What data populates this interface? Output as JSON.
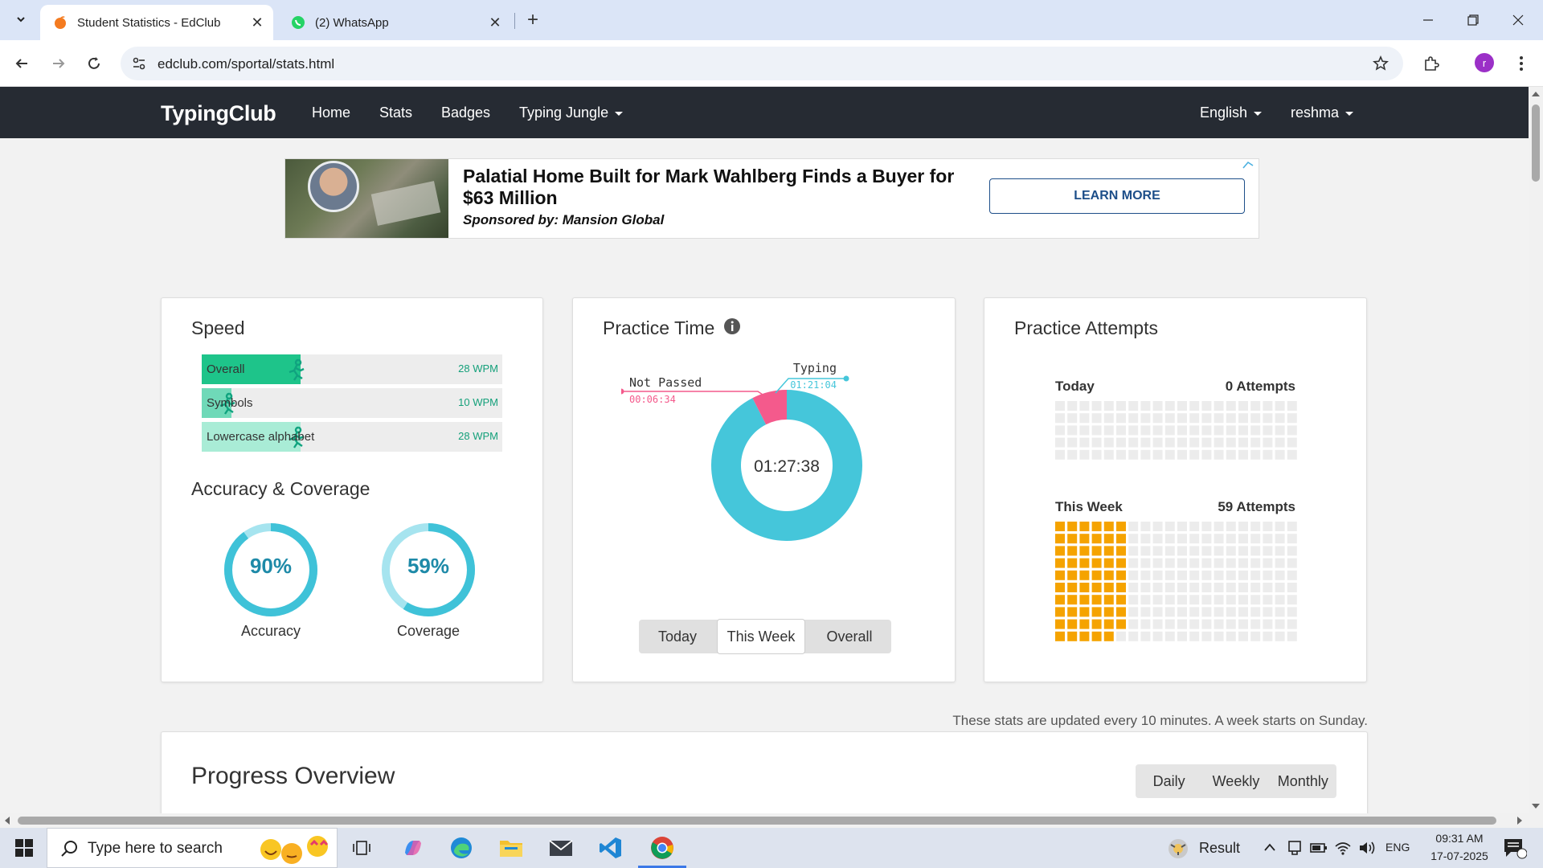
{
  "browser": {
    "tabs": [
      {
        "title": "Student Statistics - EdClub",
        "icon": "edclub-favicon",
        "active": true
      },
      {
        "title": "(2) WhatsApp",
        "icon": "whatsapp-favicon",
        "active": false
      }
    ],
    "url": "edclub.com/sportal/stats.html",
    "profile_initial": "r"
  },
  "nav": {
    "brand": "TypingClub",
    "links": [
      "Home",
      "Stats",
      "Badges",
      "Typing Jungle"
    ],
    "language": "English",
    "user": "reshma"
  },
  "ad": {
    "title": "Palatial Home Built for Mark Wahlberg Finds a Buyer for $63 Million",
    "sponsor": "Sponsored by: Mansion Global",
    "cta": "LEARN MORE"
  },
  "speed": {
    "title": "Speed",
    "rows": [
      {
        "label": "Overall",
        "value": "28 WPM",
        "fraction": 0.33,
        "color": "#1ec48a"
      },
      {
        "label": "Symbols",
        "value": "10 WPM",
        "fraction": 0.1,
        "color": "#6fd9b8"
      },
      {
        "label": "Lowercase alphabet",
        "value": "28 WPM",
        "fraction": 0.33,
        "color": "#a9ecd6"
      }
    ]
  },
  "accuracy": {
    "title": "Accuracy & Coverage",
    "items": [
      {
        "label": "Accuracy",
        "value": "90%",
        "fraction": 0.9
      },
      {
        "label": "Coverage",
        "value": "59%",
        "fraction": 0.59
      }
    ]
  },
  "practice_time": {
    "title": "Practice Time",
    "total": "01:27:38",
    "segments": [
      {
        "label": "Typing",
        "time": "01:21:04",
        "color": "#45c6da"
      },
      {
        "label": "Not Passed",
        "time": "00:06:34",
        "color": "#f45a8c"
      }
    ],
    "ranges": [
      "Today",
      "This Week",
      "Overall"
    ],
    "selected_range": "This Week"
  },
  "attempts": {
    "title": "Practice Attempts",
    "today_label": "Today",
    "today_value": "0 Attempts",
    "today_count": 0,
    "week_label": "This Week",
    "week_value": "59 Attempts",
    "week_count": 59,
    "fill_color": "#f5a300",
    "empty_color": "#ececec"
  },
  "footnote": "These stats are updated every 10 minutes. A week starts on Sunday.",
  "progress": {
    "title": "Progress Overview",
    "ranges": [
      "Daily",
      "Weekly",
      "Monthly"
    ]
  },
  "taskbar": {
    "search_placeholder": "Type here to search",
    "weather_label": "Result",
    "lang": "ENG",
    "time": "09:31 AM",
    "date": "17-07-2025"
  }
}
